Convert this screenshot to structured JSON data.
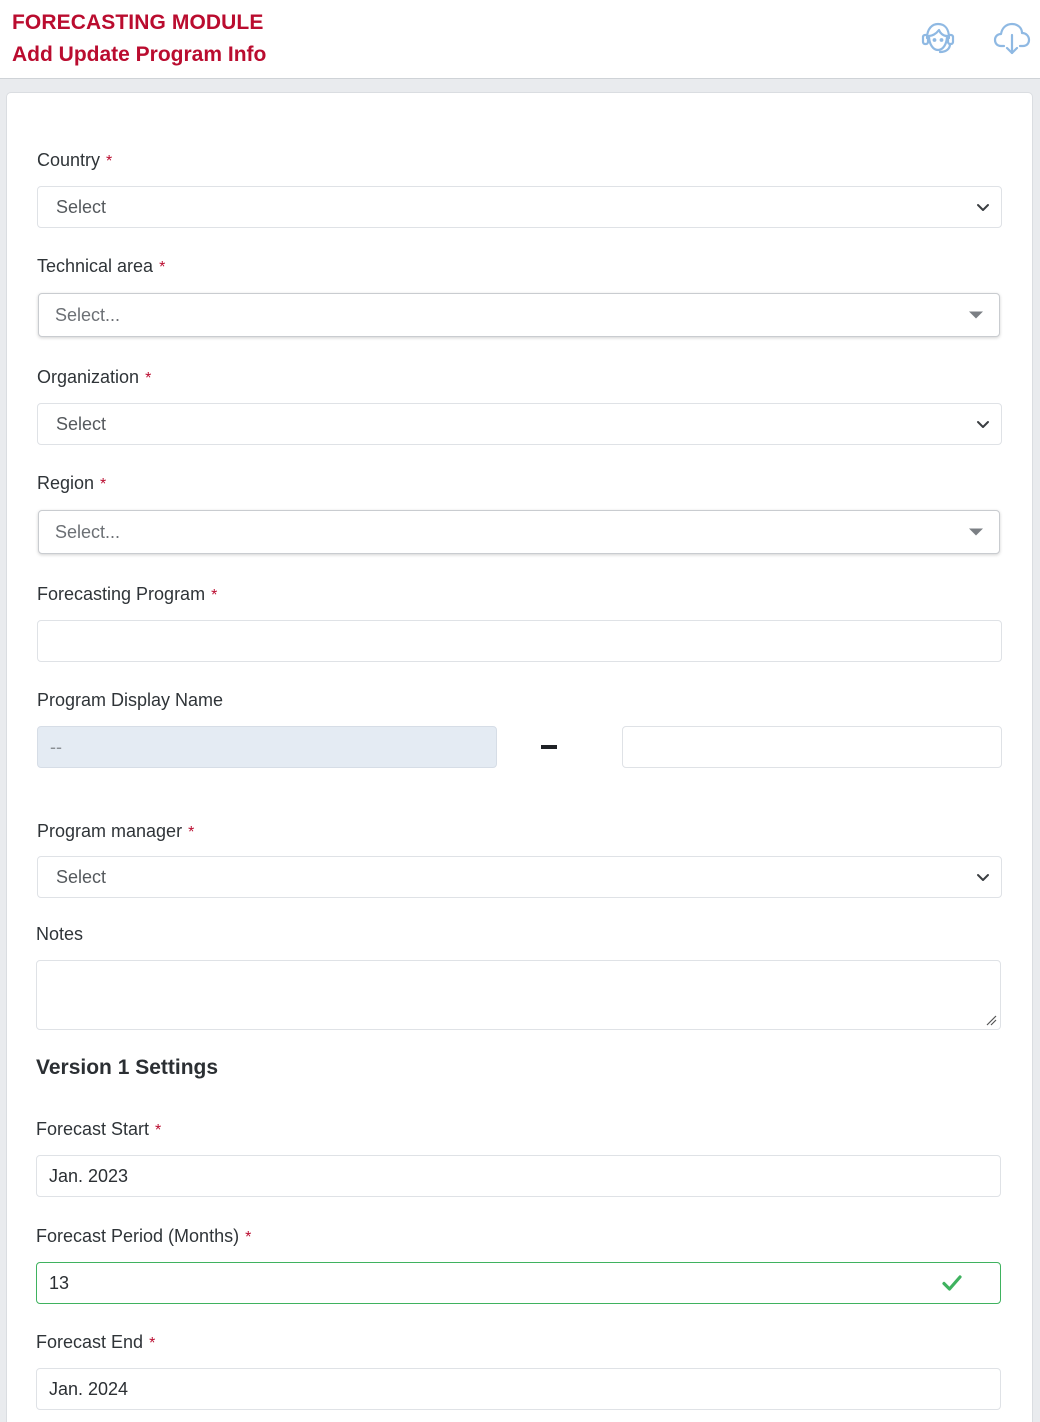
{
  "header": {
    "module_title": "FORECASTING MODULE",
    "page_title": "Add Update Program Info",
    "icons": [
      "support-agent-icon",
      "cloud-download-icon"
    ]
  },
  "form": {
    "country": {
      "label": "Country",
      "required": "*",
      "value": "Select"
    },
    "technical_area": {
      "label": "Technical area",
      "required": "*",
      "placeholder": "Select..."
    },
    "organization": {
      "label": "Organization",
      "required": "*",
      "value": "Select"
    },
    "region": {
      "label": "Region",
      "required": "*",
      "placeholder": "Select..."
    },
    "forecasting_program": {
      "label": "Forecasting Program",
      "required": "*",
      "value": ""
    },
    "program_display_name": {
      "label": "Program Display Name",
      "prefix": "--",
      "separator": "-",
      "suffix": ""
    },
    "program_manager": {
      "label": "Program manager",
      "required": "*",
      "value": "Select"
    },
    "notes": {
      "label": "Notes",
      "value": ""
    }
  },
  "version_settings": {
    "title": "Version 1 Settings",
    "forecast_start": {
      "label": "Forecast Start",
      "required": "*",
      "value": "Jan. 2023"
    },
    "forecast_period": {
      "label": "Forecast Period (Months)",
      "required": "*",
      "value": "13"
    },
    "forecast_end": {
      "label": "Forecast End",
      "required": "*",
      "value": "Jan. 2024"
    }
  },
  "colors": {
    "brand": "#ba0c2f",
    "valid": "#3fb25f",
    "icon": "#8fb9e3",
    "disabled_bg": "#e4ebf3"
  }
}
